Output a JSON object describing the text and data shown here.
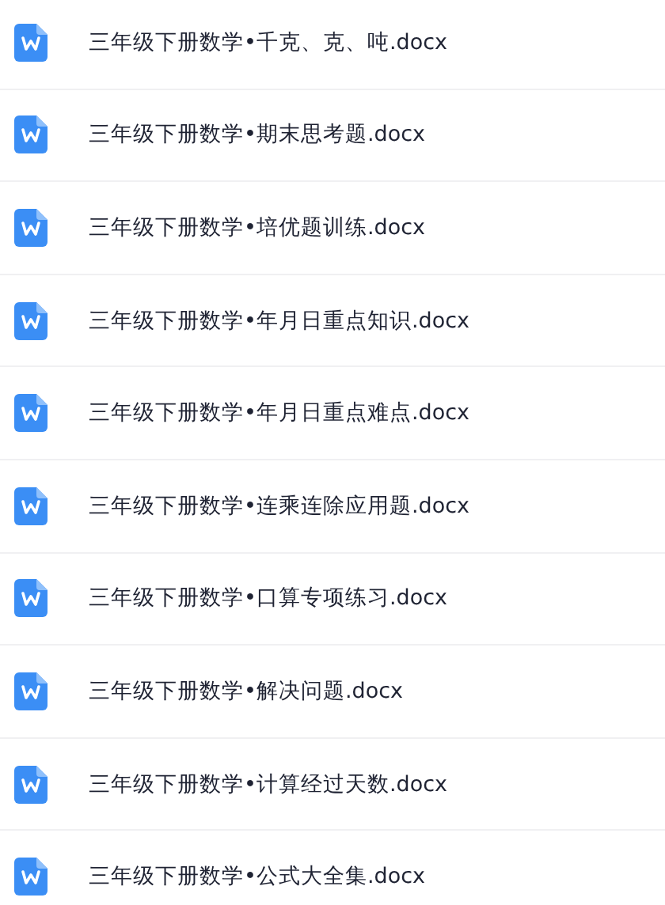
{
  "files": [
    {
      "name": "三年级下册数学•千克、克、吨.docx"
    },
    {
      "name": "三年级下册数学•期末思考题.docx"
    },
    {
      "name": "三年级下册数学•培优题训练.docx"
    },
    {
      "name": "三年级下册数学•年月日重点知识.docx"
    },
    {
      "name": "三年级下册数学•年月日重点难点.docx"
    },
    {
      "name": "三年级下册数学•连乘连除应用题.docx"
    },
    {
      "name": "三年级下册数学•口算专项练习.docx"
    },
    {
      "name": "三年级下册数学•解决问题.docx"
    },
    {
      "name": "三年级下册数学•计算经过天数.docx"
    },
    {
      "name": "三年级下册数学•公式大全集.docx"
    }
  ]
}
